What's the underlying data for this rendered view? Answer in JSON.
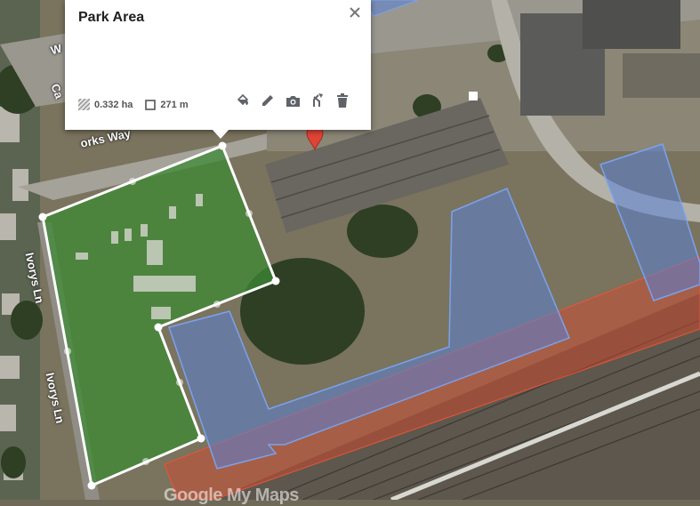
{
  "popup": {
    "title": "Park Area",
    "area": "0.332 ha",
    "perimeter": "271 m"
  },
  "map": {
    "watermark": "Google My Maps",
    "roads": {
      "top_left": "W",
      "curved_left": "Ca",
      "works_way": "orks Way",
      "lane_upper": "Ivorys Ln",
      "lane_lower": "Ivorys Ln"
    }
  },
  "colors": {
    "park_fill": "#3d8a34",
    "park_stroke": "#ffffff",
    "blue_fill": "#5a82d6",
    "blue_stroke": "#7aa2ee",
    "red_fill": "#d44a2e",
    "marker": "#e04437"
  },
  "icons": {
    "close": "close-icon",
    "area": "area-hatch-icon",
    "perimeter": "square-icon",
    "style": "paint-bucket-icon",
    "edit": "pencil-icon",
    "photo": "camera-icon",
    "directions": "directions-icon",
    "delete": "trash-icon",
    "marker": "location-marker-icon"
  }
}
